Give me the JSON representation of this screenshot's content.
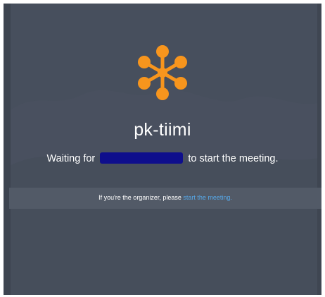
{
  "meeting": {
    "title": "pk-tiimi",
    "waiting_prefix": "Waiting for",
    "waiting_suffix": "to start the meeting.",
    "organizer_prompt": "If you're the organizer, please",
    "start_link_label": "start the meeting."
  },
  "icons": {
    "logo": "jitsi-logo-icon"
  },
  "colors": {
    "background": "#474f5d",
    "banner": "#525a67",
    "logo": "#f7951d",
    "link": "#56a8e8",
    "redaction": "#0e0e8c"
  }
}
